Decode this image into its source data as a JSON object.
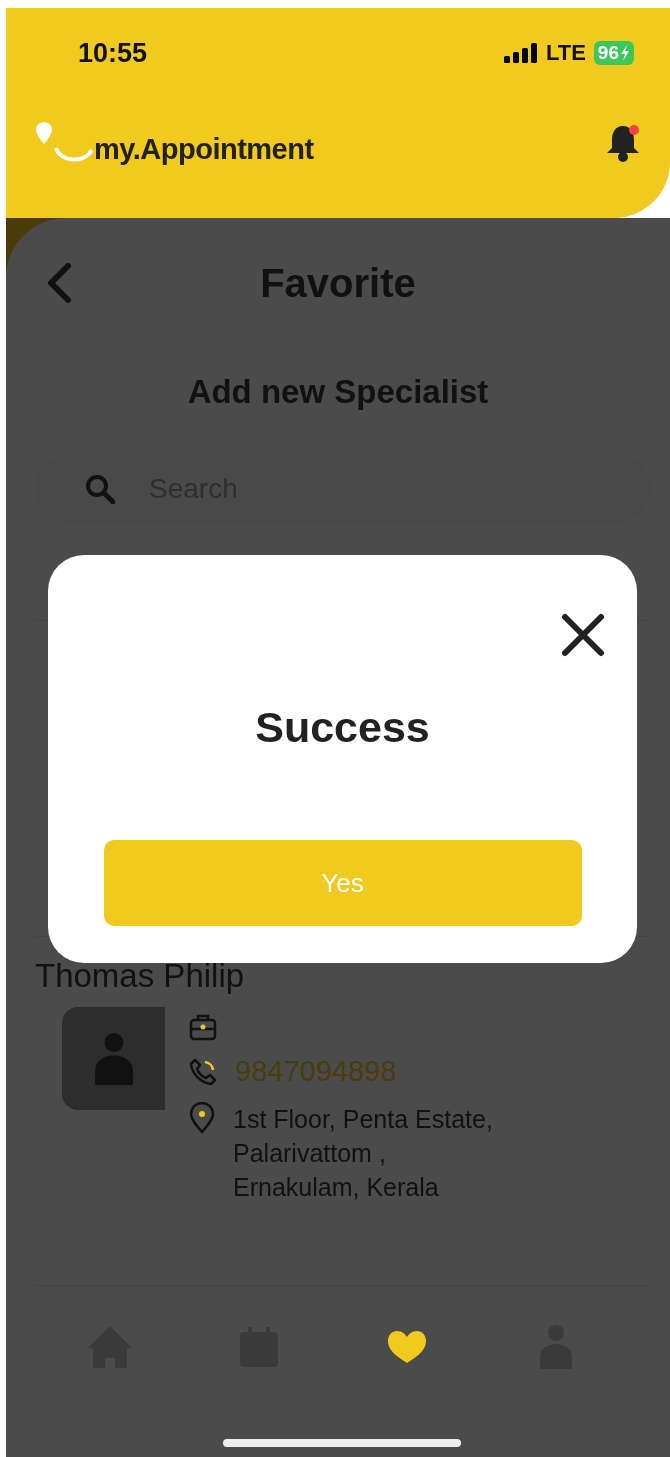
{
  "status_bar": {
    "time": "10:55",
    "network": "LTE",
    "battery": "96"
  },
  "header": {
    "logo": "my.Appointment",
    "notification_dot": true
  },
  "page": {
    "title": "Favorite",
    "subtitle": "Add new Specialist"
  },
  "search": {
    "placeholder": "Search"
  },
  "specialists": [
    {
      "name": "Thomas Philip",
      "phone": "9847094898",
      "address": [
        "1st Floor, Penta Estate,",
        "Palarivattom ,",
        "Ernakulam, Kerala"
      ]
    }
  ],
  "nav": [
    {
      "kind": "home",
      "selected": false
    },
    {
      "kind": "calendar",
      "selected": false
    },
    {
      "kind": "favorite",
      "selected": true
    },
    {
      "kind": "profile",
      "selected": false
    }
  ],
  "dialog": {
    "title": "Success",
    "button": "Yes"
  }
}
